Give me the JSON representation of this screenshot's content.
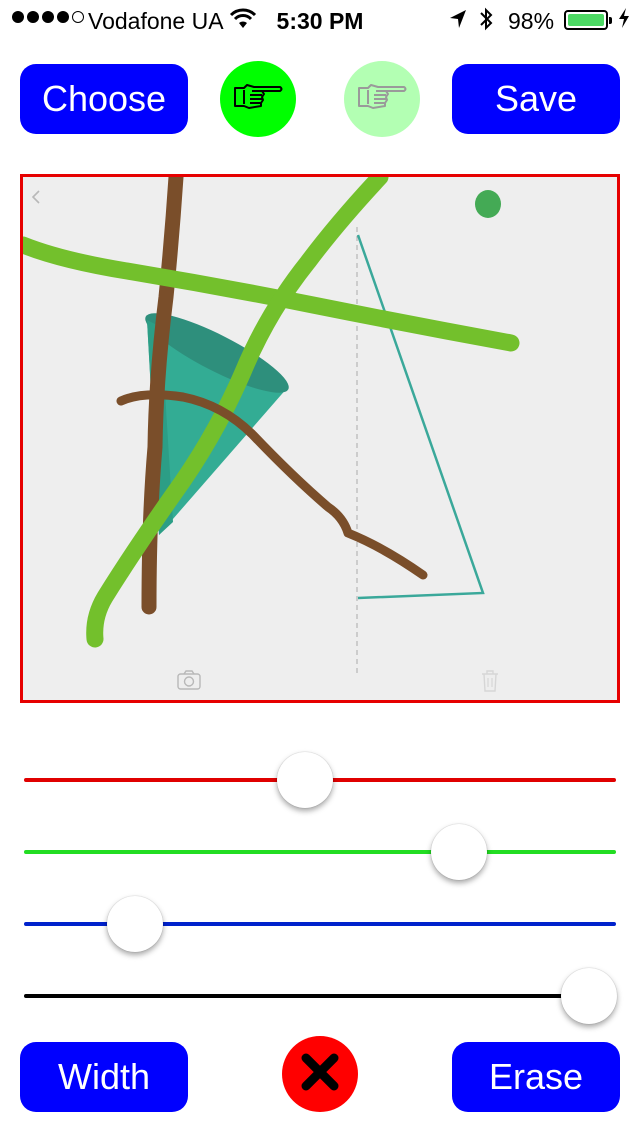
{
  "status_bar": {
    "carrier": "Vodafone UA",
    "time": "5:30 PM",
    "battery_percent": "98%",
    "battery_level": 0.98,
    "signal_bars": 4,
    "signal_total": 5,
    "icons": [
      "wifi-icon",
      "location-arrow-icon",
      "bluetooth-icon",
      "battery-icon",
      "charging-bolt-icon"
    ]
  },
  "toolbar": {
    "choose_label": "Choose",
    "save_label": "Save",
    "hand_tool_active_color": "#00ff00",
    "hand_tool_inactive_color": "#b3ffb3"
  },
  "canvas": {
    "border_color": "#e60000",
    "background": "#eeeeee",
    "icons": [
      "back-chevron-icon",
      "camera-icon",
      "trash-icon",
      "green-dot-icon"
    ]
  },
  "sliders": [
    {
      "name": "red",
      "color": "#e00000",
      "value": 0.475
    },
    {
      "name": "green",
      "color": "#22dd22",
      "value": 0.735
    },
    {
      "name": "blue",
      "color": "#0022cc",
      "value": 0.187
    },
    {
      "name": "width",
      "color": "#000000",
      "value": 0.955
    }
  ],
  "bottom_bar": {
    "width_label": "Width",
    "erase_label": "Erase",
    "clear_button_color": "#ff0000"
  }
}
